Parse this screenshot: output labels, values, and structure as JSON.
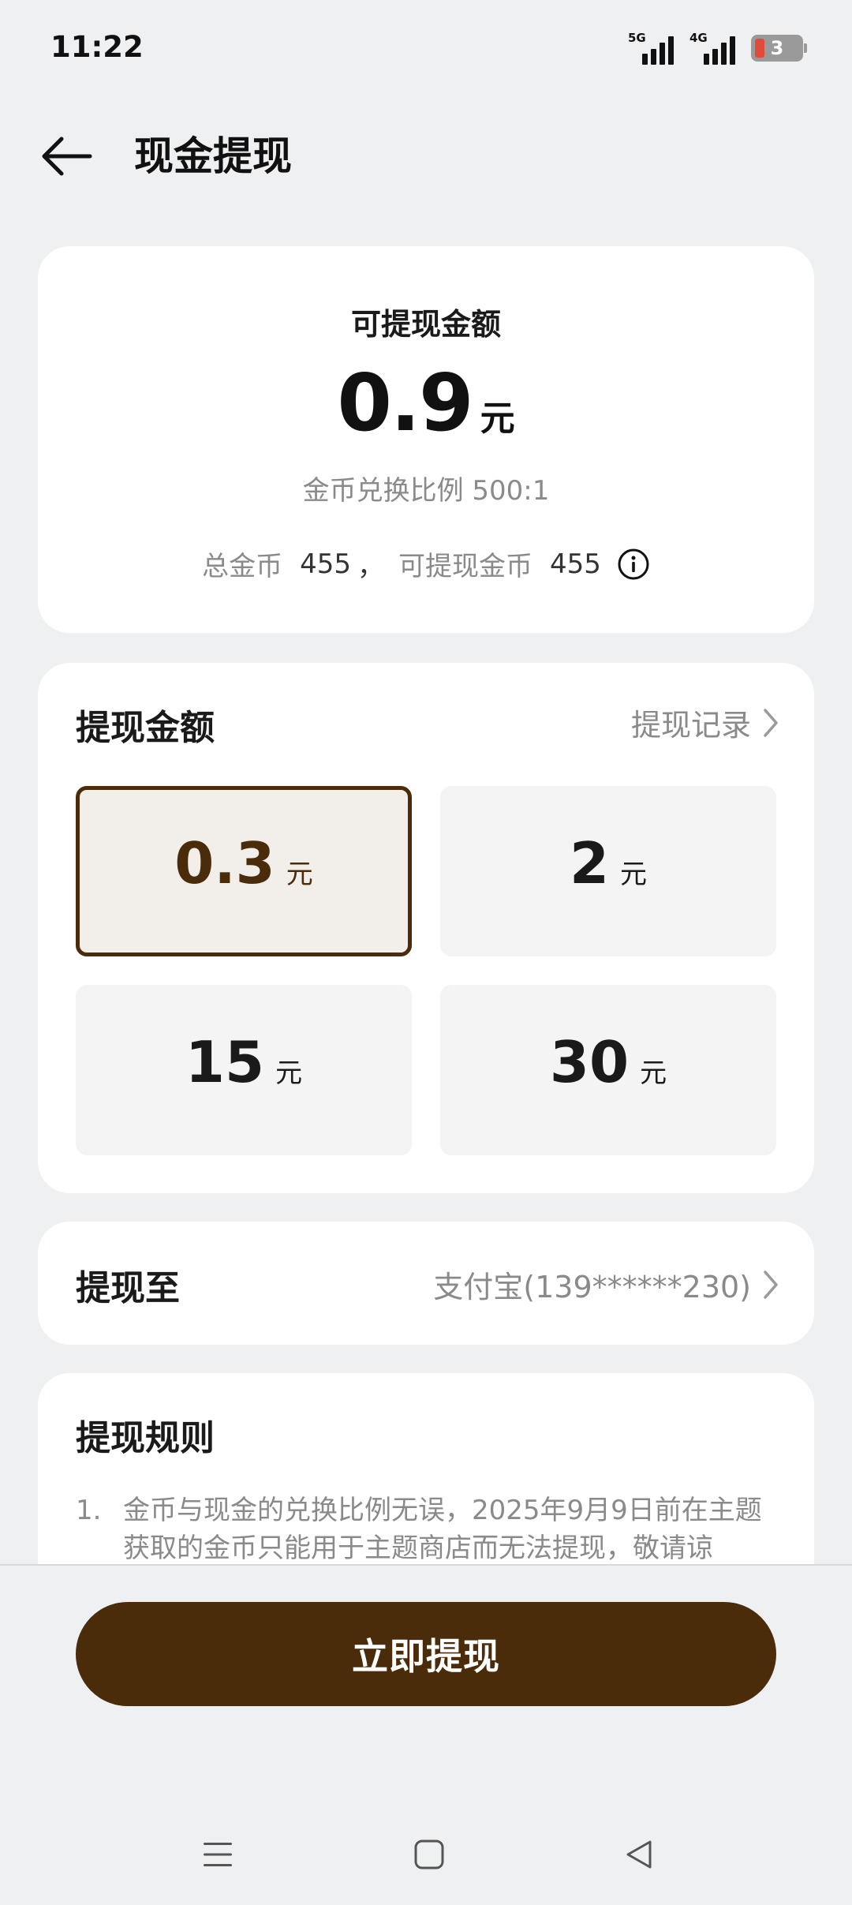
{
  "status_bar": {
    "time": "11:22",
    "signal_1_label": "5G",
    "signal_2_label": "4G",
    "battery_level": "3",
    "icons": [
      "signal-5g-icon",
      "signal-4g-icon",
      "battery-icon"
    ]
  },
  "header": {
    "title": "现金提现",
    "back_icon": "arrow-left-icon"
  },
  "balance": {
    "label": "可提现金额",
    "amount": "0.9",
    "unit": "元",
    "exchange_ratio": "金币兑换比例 500:1",
    "total_coins_label": "总金币",
    "total_coins": "455",
    "separator": "，",
    "withdrawable_coins_label": "可提现金币",
    "withdrawable_coins": "455",
    "info_icon": "info-icon"
  },
  "amount_section": {
    "title": "提现金额",
    "record_link": "提现记录",
    "options": [
      {
        "value": "0.3",
        "unit": "元",
        "selected": true
      },
      {
        "value": "2",
        "unit": "元",
        "selected": false
      },
      {
        "value": "15",
        "unit": "元",
        "selected": false
      },
      {
        "value": "30",
        "unit": "元",
        "selected": false
      }
    ]
  },
  "destination": {
    "title": "提现至",
    "value": "支付宝(139******230)"
  },
  "rules": {
    "title": "提现规则",
    "items": [
      {
        "num": "1.",
        "text": "金币与现金的兑换比例无误，2025年9月9日前在主题获取的金币只能用于主题商店而无法提现，敬请谅"
      }
    ]
  },
  "action": {
    "withdraw_label": "立即提现"
  },
  "nav_bar": {
    "icons": [
      "menu-icon",
      "home-icon",
      "back-triangle-icon"
    ]
  },
  "colors": {
    "accent": "#4a2c0a",
    "background": "#eff0f2",
    "card": "#ffffff",
    "muted_text": "#8a8a8a"
  }
}
